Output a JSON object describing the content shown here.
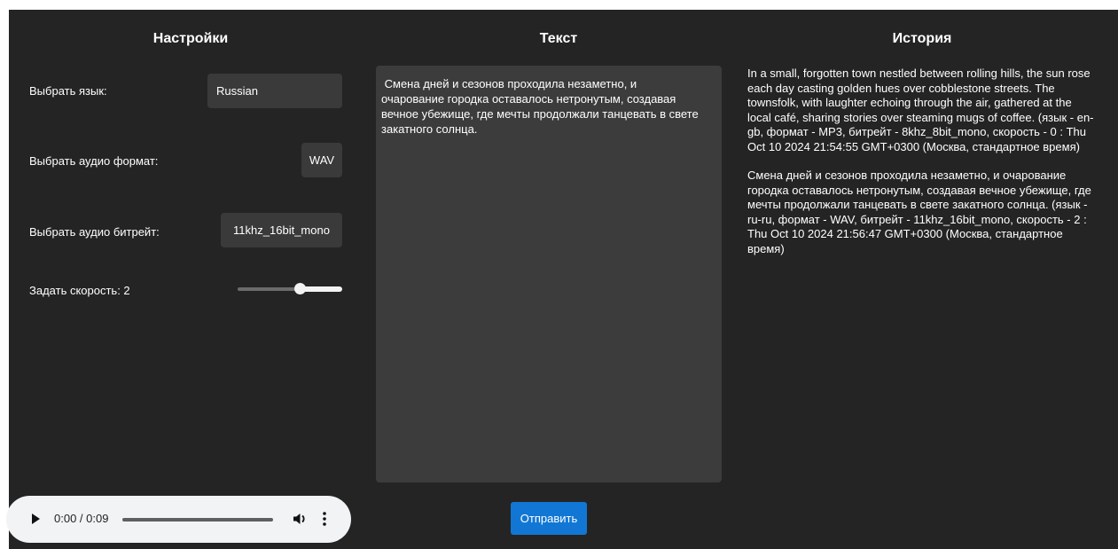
{
  "settings": {
    "title": "Настройки",
    "language_label": "Выбрать язык:",
    "language_value": "Russian",
    "format_label": "Выбрать аудио формат:",
    "format_value": "WAV",
    "bitrate_label": "Выбрать аудио битрейт:",
    "bitrate_value": "11khz_16bit_mono",
    "speed_label": "Задать скорость: 2",
    "speed_level": 0.6
  },
  "text": {
    "title": "Текст",
    "content": " Смена дней и сезонов проходила незаметно, и\nочарование городка оставалось нетронутым, создавая\nвечное убежище, где мечты продолжали танцевать в свете\nзакатного солнца.",
    "send_label": "Отправить"
  },
  "history": {
    "title": "История",
    "entries": [
      "In a small, forgotten town nestled between rolling hills, the sun rose each day casting golden hues over cobblestone streets. The townsfolk, with laughter echoing through the air, gathered at the local café, sharing stories over steaming mugs of coffee. (язык - en-gb, формат - MP3, битрейт - 8khz_8bit_mono, скорость - 0 : Thu Oct 10 2024 21:54:55 GMT+0300 (Москва, стандартное время)",
      "Смена дней и сезонов проходила незаметно, и очарование городка оставалось нетронутым, создавая вечное убежище, где мечты продолжали танцевать в свете закатного солнца. (язык - ru-ru, формат - WAV, битрейт - 11khz_16bit_mono, скорость - 2 : Thu Oct 10 2024 21:56:47 GMT+0300 (Москва, стандартное время)"
    ]
  },
  "player": {
    "time": "0:00 / 0:09",
    "icons": [
      "play-icon",
      "volume-icon",
      "more-options-icon"
    ]
  }
}
